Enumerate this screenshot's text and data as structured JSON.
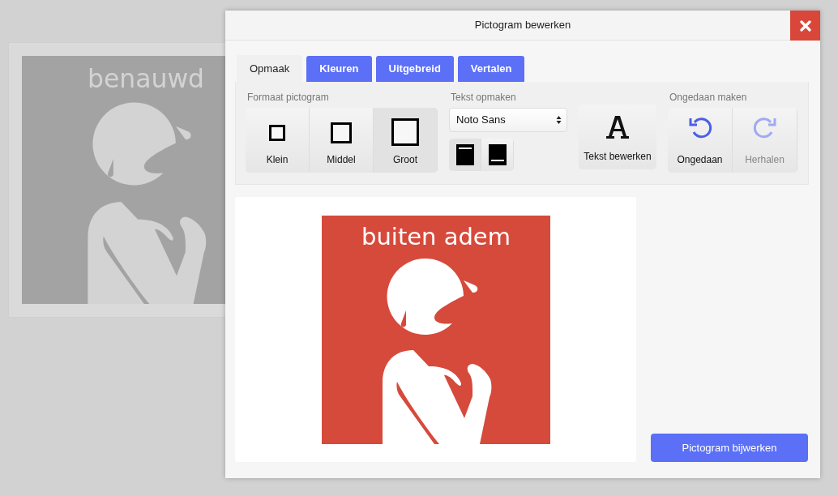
{
  "background": {
    "pictogram": {
      "label": "benauwd"
    }
  },
  "dialog": {
    "title": "Pictogram bewerken",
    "tabs": [
      {
        "label": "Opmaak",
        "selected": true
      },
      {
        "label": "Kleuren",
        "selected": false
      },
      {
        "label": "Uitgebreid",
        "selected": false
      },
      {
        "label": "Vertalen",
        "selected": false
      }
    ],
    "size_group": {
      "label": "Formaat pictogram",
      "options": [
        {
          "label": "Klein",
          "kind": "small",
          "selected": false
        },
        {
          "label": "Middel",
          "kind": "medium",
          "selected": false
        },
        {
          "label": "Groot",
          "kind": "large",
          "selected": true
        }
      ]
    },
    "text_group": {
      "label": "Tekst opmaken",
      "font": "Noto Sans",
      "positions": [
        {
          "kind": "top",
          "selected": true
        },
        {
          "kind": "bottom",
          "selected": false
        }
      ],
      "edit_button": "Tekst bewerken"
    },
    "undo_group": {
      "label": "Ongedaan maken",
      "buttons": [
        {
          "label": "Ongedaan",
          "kind": "undo",
          "disabled": false
        },
        {
          "label": "Herhalen",
          "kind": "redo",
          "disabled": true
        }
      ]
    },
    "preview": {
      "label": "buiten adem"
    },
    "submit": "Pictogram bijwerken"
  }
}
